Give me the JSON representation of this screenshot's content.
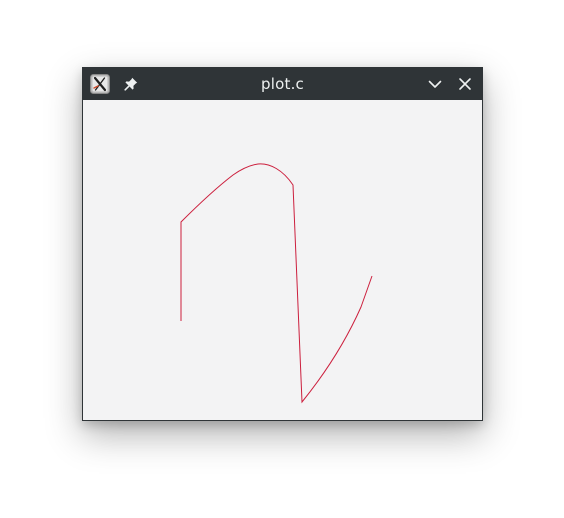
{
  "window": {
    "title": "plot.c"
  },
  "titlebar": {
    "icons": {
      "app": "app-x-icon",
      "pin": "pin-icon",
      "minimize": "chevron-down-icon",
      "close": "close-icon"
    }
  },
  "colors": {
    "titlebar_bg": "#2f3437",
    "canvas_bg": "#f3f3f4",
    "curve": "#cc1f3d"
  }
}
